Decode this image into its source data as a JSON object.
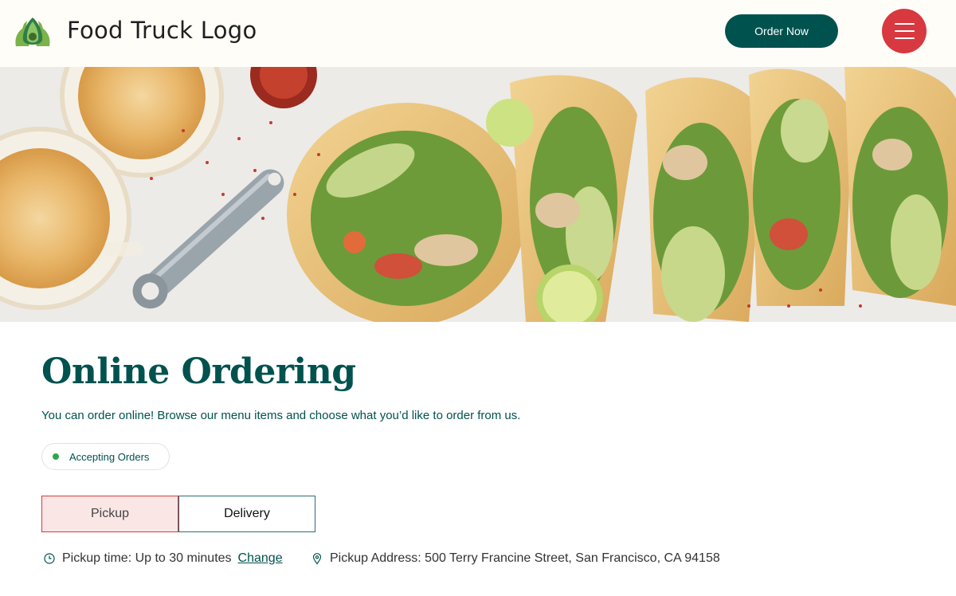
{
  "header": {
    "logo_text": "Food Truck Logo",
    "logo_icon": "avocado-icon",
    "order_button": "Order Now",
    "menu_icon": "hamburger-menu-icon"
  },
  "hero": {
    "image_icon": "tacos-hero-image"
  },
  "main": {
    "title": "Online Ordering",
    "subtitle": "You can order online! Browse our menu items and choose what you’d like to order from us.",
    "status": "Accepting Orders",
    "tabs": [
      {
        "label": "Pickup",
        "selected": true
      },
      {
        "label": "Delivery",
        "selected": false
      }
    ],
    "pickup_time": "Pickup time: Up to 30 minutes",
    "change_label": "Change",
    "pickup_address": "Pickup Address: 500 Terry Francine Street, San Francisco, CA 94158"
  },
  "colors": {
    "brand_dark": "#00524f",
    "accent_red": "#d8383f",
    "status_green": "#2ba84a",
    "pickup_tab_bg": "#fbe6e6"
  }
}
